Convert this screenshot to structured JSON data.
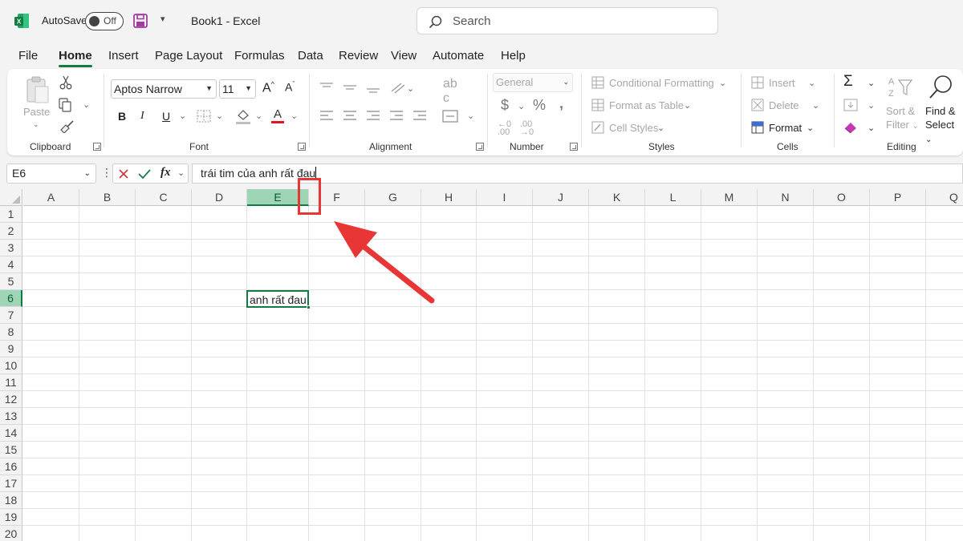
{
  "titlebar": {
    "autosave_label": "AutoSave",
    "autosave_state": "Off",
    "document_title": "Book1  -  Excel",
    "search_placeholder": "Search"
  },
  "tabs": [
    "File",
    "Home",
    "Insert",
    "Page Layout",
    "Formulas",
    "Data",
    "Review",
    "View",
    "Automate",
    "Help"
  ],
  "active_tab": "Home",
  "ribbon": {
    "clipboard": {
      "label": "Clipboard",
      "paste": "Paste"
    },
    "font": {
      "label": "Font",
      "font_name": "Aptos Narrow",
      "font_size": "11"
    },
    "alignment": {
      "label": "Alignment"
    },
    "number": {
      "label": "Number",
      "format": "General"
    },
    "styles": {
      "label": "Styles",
      "conditional_formatting": "Conditional Formatting",
      "format_as_table": "Format as Table",
      "cell_styles": "Cell Styles"
    },
    "cells": {
      "label": "Cells",
      "insert": "Insert",
      "delete": "Delete",
      "format": "Format"
    },
    "editing": {
      "label": "Editing",
      "sort_filter_1": "Sort &",
      "sort_filter_2": "Filter",
      "find_select_1": "Find &",
      "find_select_2": "Select"
    }
  },
  "formula_bar": {
    "name_box": "E6",
    "formula": "trái tim của anh rất đau"
  },
  "grid": {
    "columns": [
      "A",
      "B",
      "C",
      "D",
      "E",
      "F",
      "G",
      "H",
      "I",
      "J",
      "K",
      "L",
      "M",
      "N",
      "O",
      "P",
      "Q"
    ],
    "rows": [
      "1",
      "2",
      "3",
      "4",
      "5",
      "6",
      "7",
      "8",
      "9",
      "10",
      "11",
      "12",
      "13",
      "14",
      "15",
      "16",
      "17",
      "18",
      "19",
      "20"
    ],
    "selected_column": "E",
    "selected_row": "6",
    "active_cell_text": "anh rất đau"
  },
  "colors": {
    "accent": "#107c41",
    "annotation": "#e83535"
  }
}
